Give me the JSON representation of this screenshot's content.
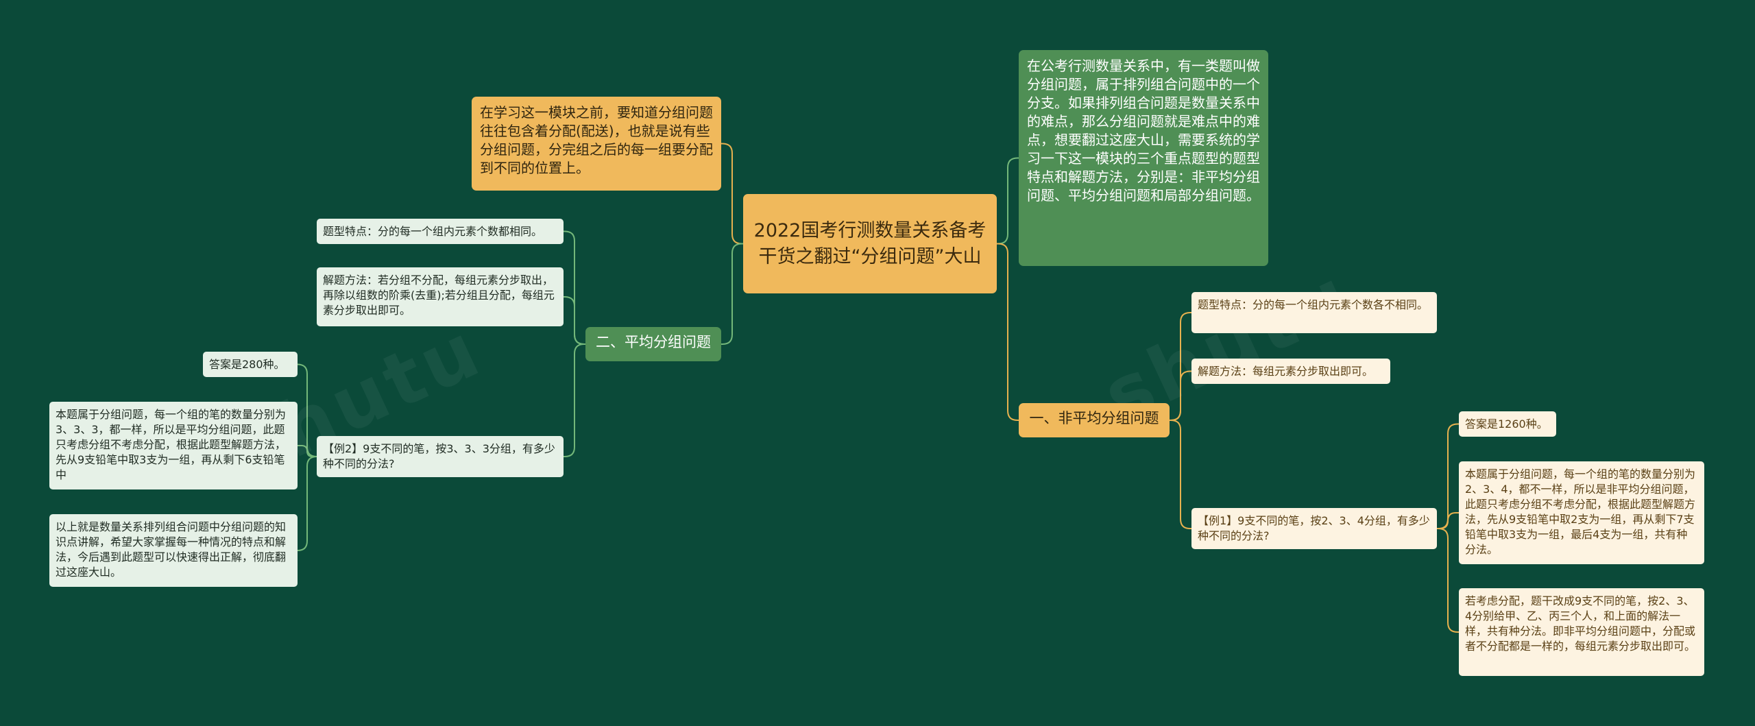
{
  "colors": {
    "background": "#0b4a39",
    "orange": "#f0b95c",
    "green": "#4f8f55",
    "line_green": "#74b87a",
    "line_orange": "#e7b14f"
  },
  "root": {
    "text": "2022国考行测数量关系备考干货之翻过“分组问题”大山"
  },
  "intro_left": {
    "text": "在学习这一模块之前，要知道分组问题往往包含着分配(配送)，也就是说有些分组问题，分完组之后的每一组要分配到不同的位置上。"
  },
  "intro_right": {
    "text": "在公考行测数量关系中，有一类题叫做分组问题，属于排列组合问题中的一个分支。如果排列组合问题是数量关系中的难点，那么分组问题就是难点中的难点，想要翻过这座大山，需要系统的学习一下这一模块的三个重点题型的题型特点和解题方法，分别是：非平均分组问题、平均分组问题和局部分组问题。"
  },
  "branch_average": {
    "label": "二、平均分组问题",
    "feature": "题型特点：分的每一个组内元素个数都相同。",
    "method": "解题方法：若分组不分配，每组元素分步取出，再除以组数的阶乘(去重);若分组且分配，每组元素分步取出即可。",
    "example": "【例2】9支不同的笔，按3、3、3分组，有多少种不同的分法?",
    "answer": "答案是280种。",
    "explanation": "本题属于分组问题，每一个组的笔的数量分别为3、3、3，都一样，所以是平均分组问题，此题只考虑分组不考虑分配，根据此题型解题方法，先从9支铅笔中取3支为一组，再从剩下6支铅笔中",
    "summary": "以上就是数量关系排列组合问题中分组问题的知识点讲解，希望大家掌握每一种情况的特点和解法，今后遇到此题型可以快速得出正解，彻底翻过这座大山。"
  },
  "branch_nonaverage": {
    "label": "一、非平均分组问题",
    "feature": "题型特点：分的每一个组内元素个数各不相同。",
    "method": "解题方法：每组元素分步取出即可。",
    "example": "【例1】9支不同的笔，按2、3、4分组，有多少种不同的分法?",
    "answer": "答案是1260种。",
    "explanation": "本题属于分组问题，每一个组的笔的数量分别为2、3、4，都不一样，所以是非平均分组问题，此题只考虑分组不考虑分配，根据此题型解题方法，先从9支铅笔中取2支为一组，再从剩下7支铅笔中取3支为一组，最后4支为一组，共有种分法。",
    "variant": "若考虑分配，题干改成9支不同的笔，按2、3、4分别给甲、乙、丙三个人，和上面的解法一样，共有种分法。即非平均分组问题中，分配或者不分配都是一样的，每组元素分步取出即可。"
  }
}
